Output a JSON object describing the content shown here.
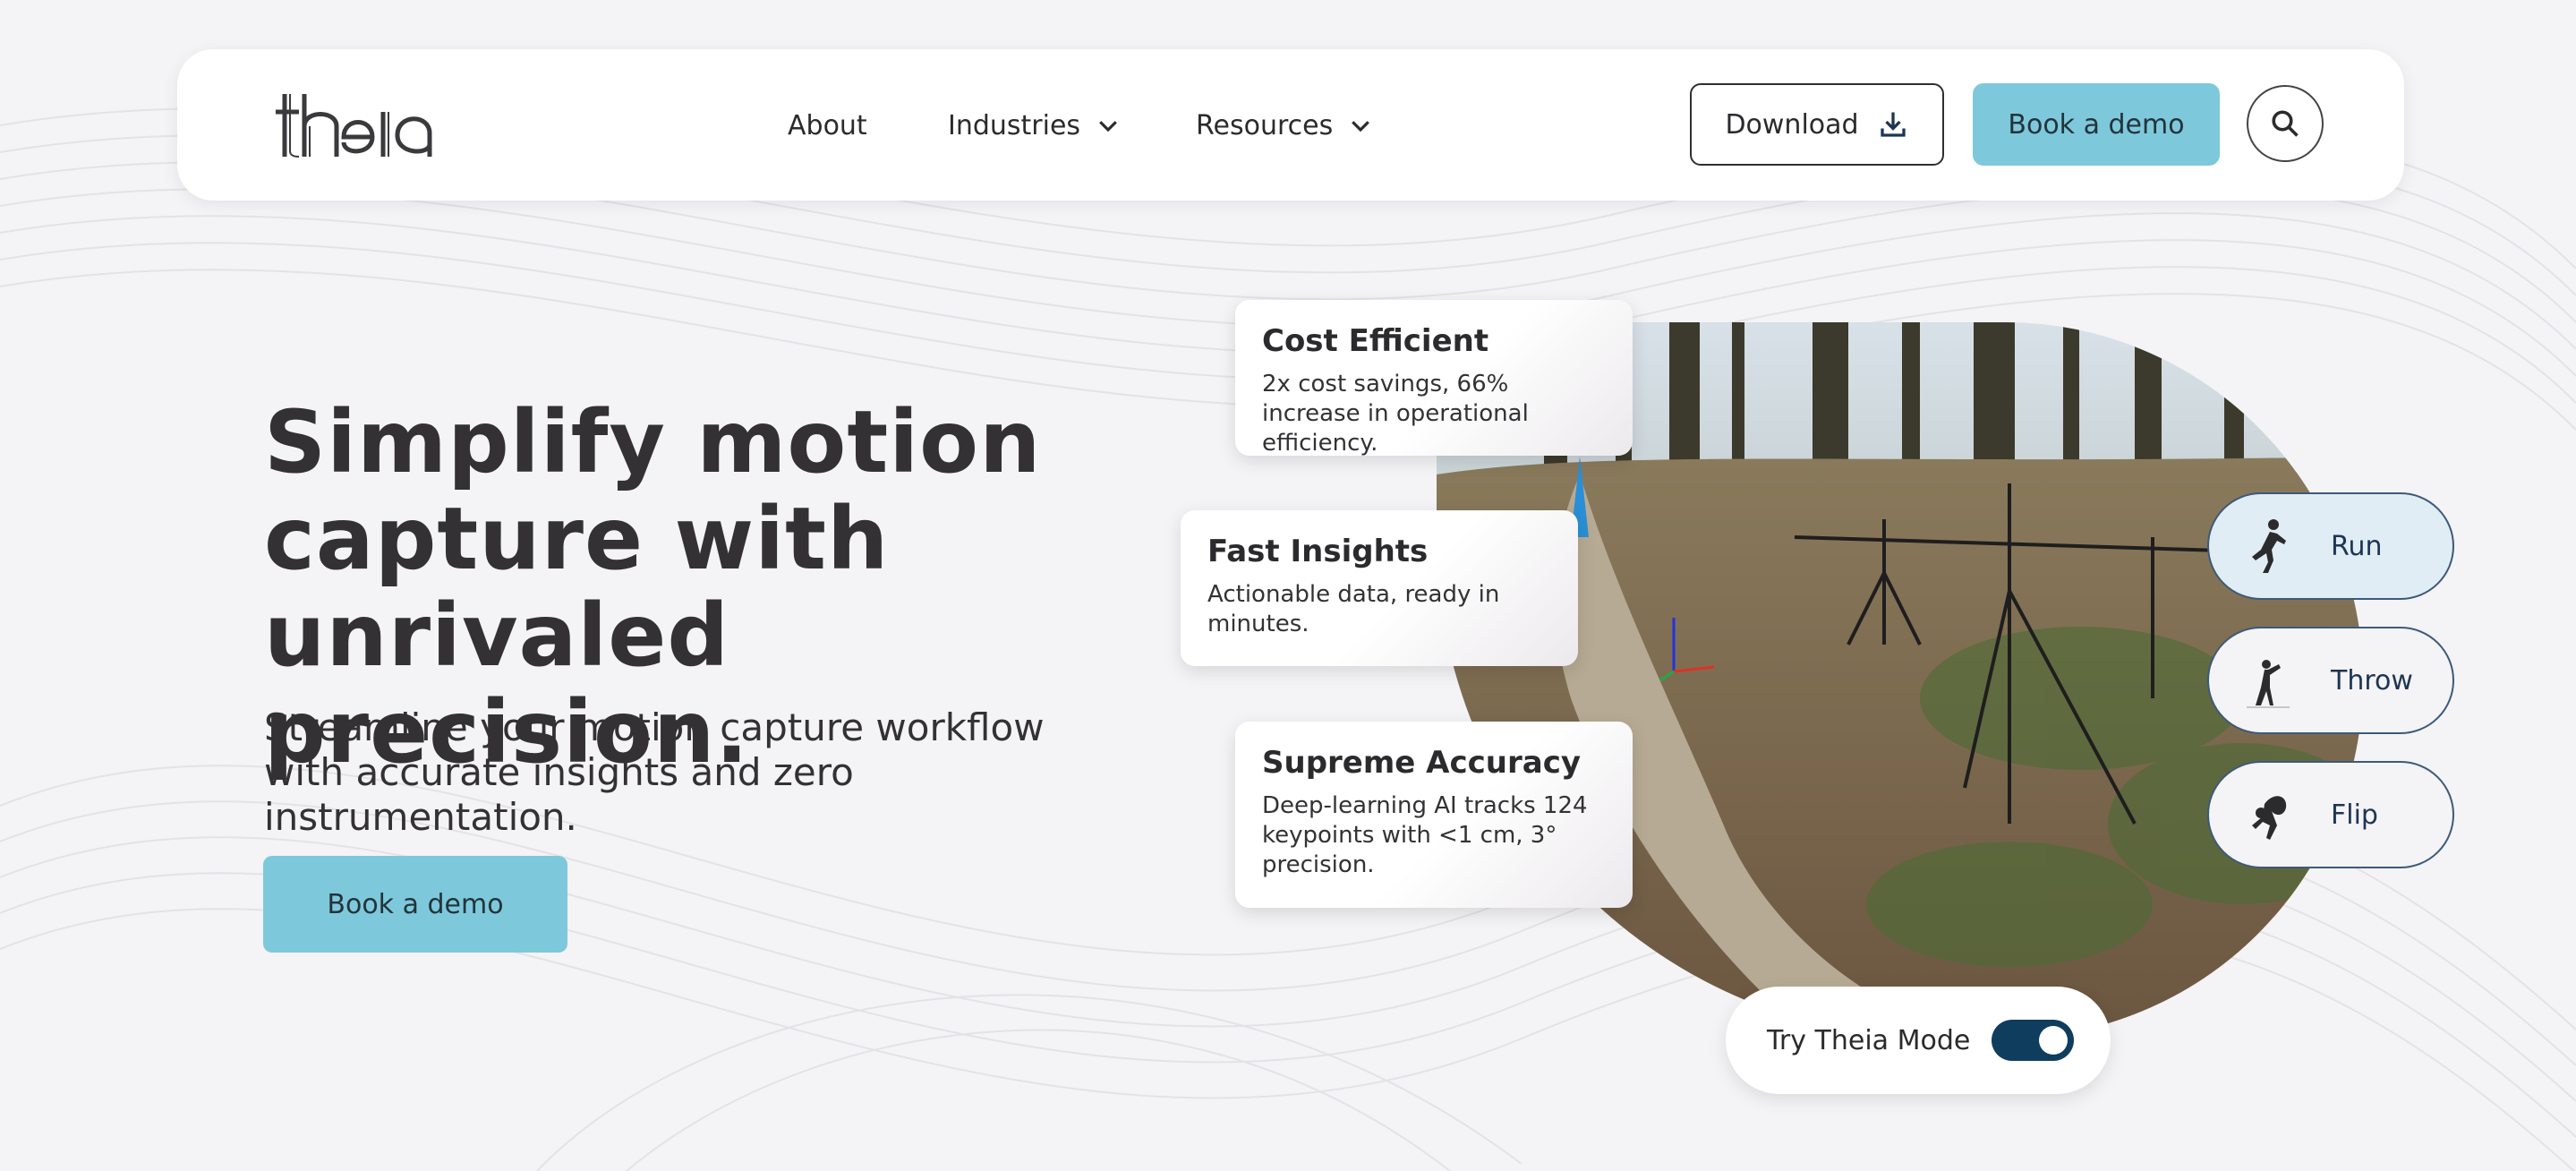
{
  "brand": {
    "logo_text": "theia"
  },
  "nav": {
    "about": "About",
    "industries": "Industries",
    "resources": "Resources",
    "download": "Download",
    "book_demo": "Book a demo"
  },
  "hero": {
    "title": "Simplify motion capture with unrivaled precision.",
    "subtitle": "Streamline your motion capture workflow with accurate insights and zero instrumentation.",
    "cta": "Book a demo"
  },
  "features": [
    {
      "title": "Cost Efficient",
      "desc": "2x cost savings, 66% increase in operational efficiency."
    },
    {
      "title": "Fast Insights",
      "desc": "Actionable data, ready in minutes."
    },
    {
      "title": "Supreme Accuracy",
      "desc": "Deep-learning AI tracks 124 keypoints with <1 cm, 3° precision."
    }
  ],
  "activities": [
    {
      "label": "Run",
      "icon": "runner-icon",
      "active": true
    },
    {
      "label": "Throw",
      "icon": "thrower-icon",
      "active": false
    },
    {
      "label": "Flip",
      "icon": "flip-icon",
      "active": false
    }
  ],
  "toggle": {
    "label": "Try Theia Mode",
    "on": true
  },
  "colors": {
    "accent": "#7ec8dc",
    "toggle": "#0f3d5e",
    "pill_border": "#3c5a78",
    "text": "#333134",
    "background": "#f4f3f5"
  }
}
